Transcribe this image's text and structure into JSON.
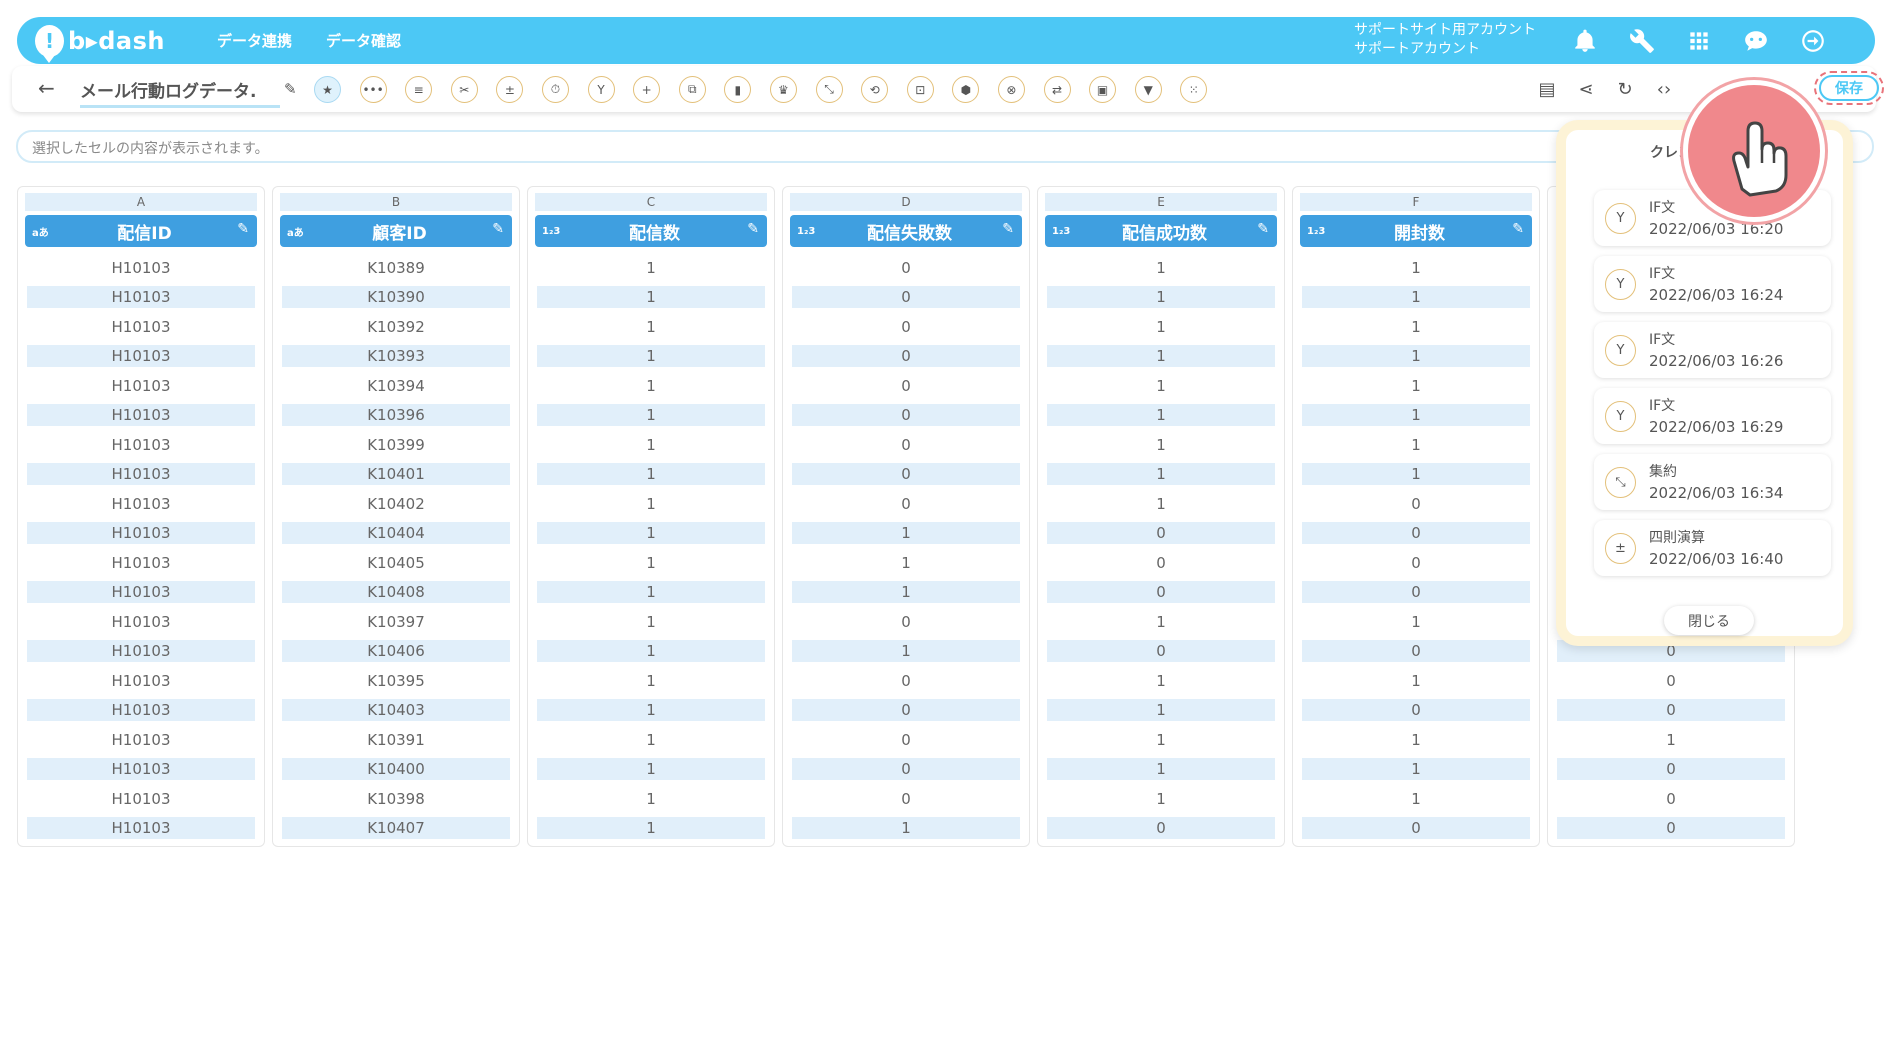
{
  "header": {
    "logo_text": "b▸dash",
    "nav": [
      "データ連携",
      "データ確認"
    ],
    "account_line1": "サポートサイト用アカウント",
    "account_line2": "サポートアカウント"
  },
  "toolbar": {
    "data_title": "メール行動ログデータ.",
    "save_label": "保存"
  },
  "cellbar": {
    "placeholder": "選択したセルの内容が表示されます。"
  },
  "columns": [
    {
      "letter": "A",
      "type": "aあ",
      "name": "配信ID"
    },
    {
      "letter": "B",
      "type": "aあ",
      "name": "顧客ID"
    },
    {
      "letter": "C",
      "type": "1₂3",
      "name": "配信数"
    },
    {
      "letter": "D",
      "type": "1₂3",
      "name": "配信失敗数"
    },
    {
      "letter": "E",
      "type": "1₂3",
      "name": "配信成功数"
    },
    {
      "letter": "F",
      "type": "1₂3",
      "name": "開封数"
    }
  ],
  "rows": [
    [
      "H10103",
      "K10389",
      "1",
      "0",
      "1",
      "1",
      ""
    ],
    [
      "H10103",
      "K10390",
      "1",
      "0",
      "1",
      "1",
      ""
    ],
    [
      "H10103",
      "K10392",
      "1",
      "0",
      "1",
      "1",
      ""
    ],
    [
      "H10103",
      "K10393",
      "1",
      "0",
      "1",
      "1",
      ""
    ],
    [
      "H10103",
      "K10394",
      "1",
      "0",
      "1",
      "1",
      ""
    ],
    [
      "H10103",
      "K10396",
      "1",
      "0",
      "1",
      "1",
      ""
    ],
    [
      "H10103",
      "K10399",
      "1",
      "0",
      "1",
      "1",
      ""
    ],
    [
      "H10103",
      "K10401",
      "1",
      "0",
      "1",
      "1",
      ""
    ],
    [
      "H10103",
      "K10402",
      "1",
      "0",
      "1",
      "0",
      ""
    ],
    [
      "H10103",
      "K10404",
      "1",
      "1",
      "0",
      "0",
      ""
    ],
    [
      "H10103",
      "K10405",
      "1",
      "1",
      "0",
      "0",
      ""
    ],
    [
      "H10103",
      "K10408",
      "1",
      "1",
      "0",
      "0",
      ""
    ],
    [
      "H10103",
      "K10397",
      "1",
      "0",
      "1",
      "1",
      ""
    ],
    [
      "H10103",
      "K10406",
      "1",
      "1",
      "0",
      "0",
      "0"
    ],
    [
      "H10103",
      "K10395",
      "1",
      "0",
      "1",
      "1",
      "0"
    ],
    [
      "H10103",
      "K10403",
      "1",
      "0",
      "1",
      "0",
      "0"
    ],
    [
      "H10103",
      "K10391",
      "1",
      "0",
      "1",
      "1",
      "1"
    ],
    [
      "H10103",
      "K10400",
      "1",
      "0",
      "1",
      "1",
      "0"
    ],
    [
      "H10103",
      "K10398",
      "1",
      "0",
      "1",
      "1",
      "0"
    ],
    [
      "H10103",
      "K10407",
      "1",
      "1",
      "0",
      "0",
      "0"
    ]
  ],
  "history_popup": {
    "title": "クレン",
    "items": [
      {
        "name": "IF文",
        "date": "2022/06/03 16:20",
        "icon": "branch-icon"
      },
      {
        "name": "IF文",
        "date": "2022/06/03 16:24",
        "icon": "branch-icon"
      },
      {
        "name": "IF文",
        "date": "2022/06/03 16:26",
        "icon": "branch-icon"
      },
      {
        "name": "IF文",
        "date": "2022/06/03 16:29",
        "icon": "branch-icon"
      },
      {
        "name": "集約",
        "date": "2022/06/03 16:34",
        "icon": "aggregate-icon"
      },
      {
        "name": "四則演算",
        "date": "2022/06/03 16:40",
        "icon": "arithmetic-icon"
      }
    ],
    "close_label": "閉じる"
  },
  "colors": {
    "header_bg": "#4cc8f5",
    "column_header_bg": "#3f9fe0",
    "row_stripe": "#e1effa",
    "highlight": "#f0888c"
  }
}
